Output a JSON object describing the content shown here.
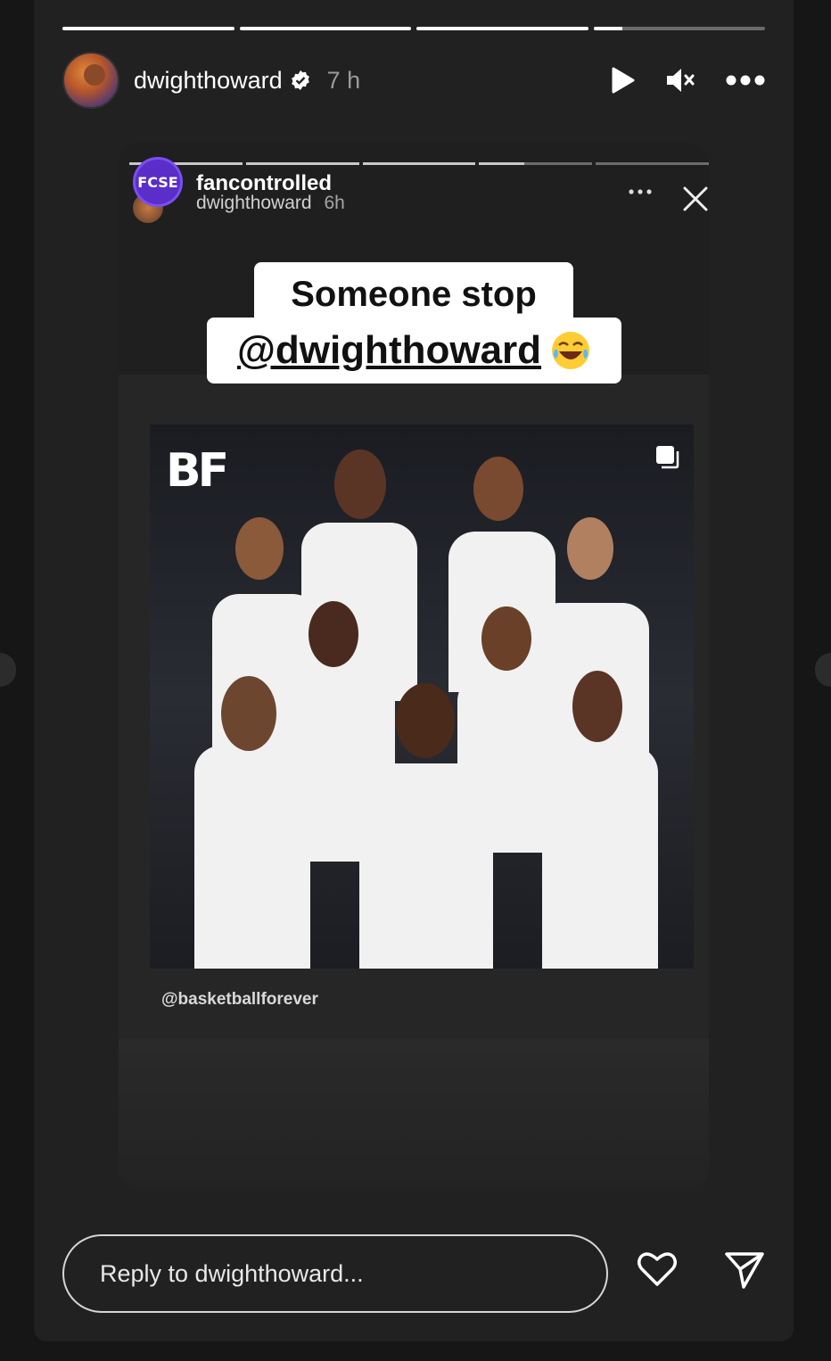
{
  "story": {
    "progress_segments": [
      1,
      1,
      1,
      0.17
    ],
    "username": "dwighthoward",
    "time": "7 h",
    "icons": {
      "avatar": "profile-avatar",
      "verified": "verified-badge-icon",
      "play": "play-icon",
      "mute": "speaker-muted-icon",
      "more": "more-options-icon"
    }
  },
  "shared_post": {
    "progress_segments": [
      1,
      1,
      1,
      0.4,
      0
    ],
    "avatar_text": "FCSE",
    "account": "fancontrolled",
    "sub_account": "dwighthoward",
    "sub_time": "6h",
    "sticker_line1": "Someone stop",
    "sticker_line2": "@dwighthoward",
    "image_logo": "BF",
    "credit": "@basketballforever",
    "slider_value": 0
  },
  "reply": {
    "placeholder": "Reply to dwighthoward..."
  },
  "colors": {
    "background": "#161616",
    "card": "#212121",
    "inner_card": "#262626",
    "accent_purple": "#5b2dc9"
  }
}
